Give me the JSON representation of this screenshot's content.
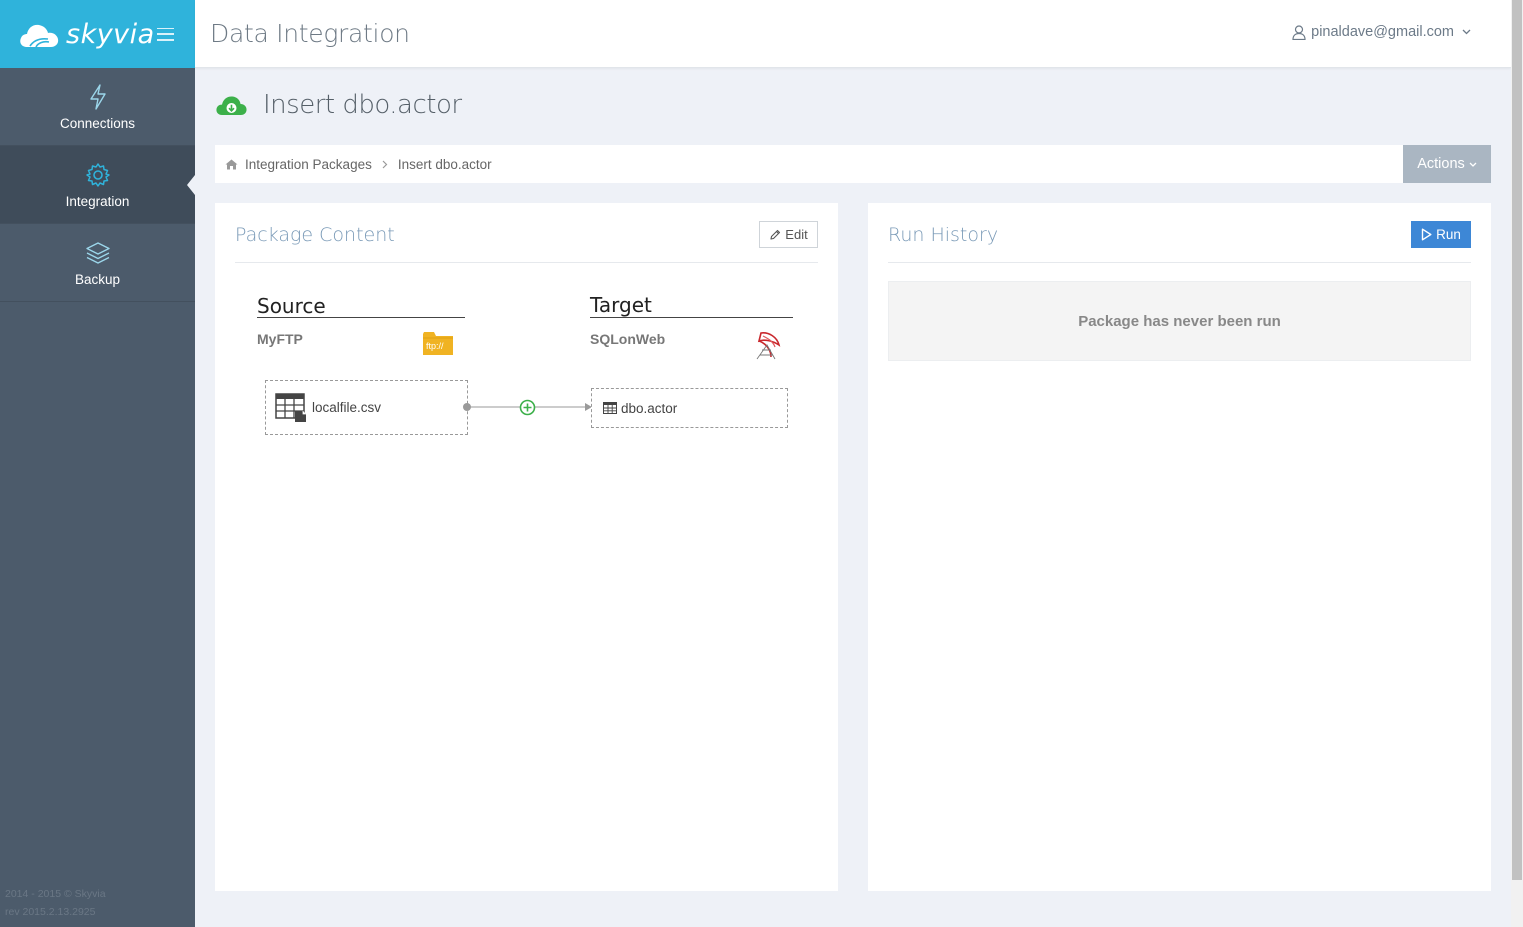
{
  "app": {
    "brand": "skyvia",
    "section_title": "Data Integration",
    "user_email": "pinaldave@gmail.com"
  },
  "sidebar": {
    "items": [
      {
        "label": "Connections",
        "icon": "lightning-icon",
        "active": false
      },
      {
        "label": "Integration",
        "icon": "gear-icon",
        "active": true
      },
      {
        "label": "Backup",
        "icon": "layers-icon",
        "active": false
      }
    ],
    "footer": {
      "copyright": "2014 - 2015 © Skyvia",
      "revision": "rev 2015.2.13.2925"
    }
  },
  "page": {
    "title": "Insert dbo.actor",
    "icon": "cloud-download-icon"
  },
  "breadcrumb": {
    "home_icon": "home-icon",
    "items": [
      "Integration Packages",
      "Insert dbo.actor"
    ],
    "actions_label": "Actions"
  },
  "package_content": {
    "title": "Package Content",
    "edit_label": "Edit",
    "source": {
      "heading": "Source",
      "connection": "MyFTP",
      "connector_badge": "ftp://",
      "object": "localfile.csv"
    },
    "target": {
      "heading": "Target",
      "connection": "SQLonWeb",
      "object": "dbo.actor"
    }
  },
  "run_history": {
    "title": "Run History",
    "run_label": "Run",
    "empty_message": "Package has never been run"
  },
  "colors": {
    "brand_blue": "#2fb3db",
    "sidebar": "#4c5b6b",
    "run_button": "#3d87d6",
    "panel_title": "#7a9ab7",
    "ftp_folder": "#f0b323",
    "mapping_green": "#3cb04a"
  }
}
